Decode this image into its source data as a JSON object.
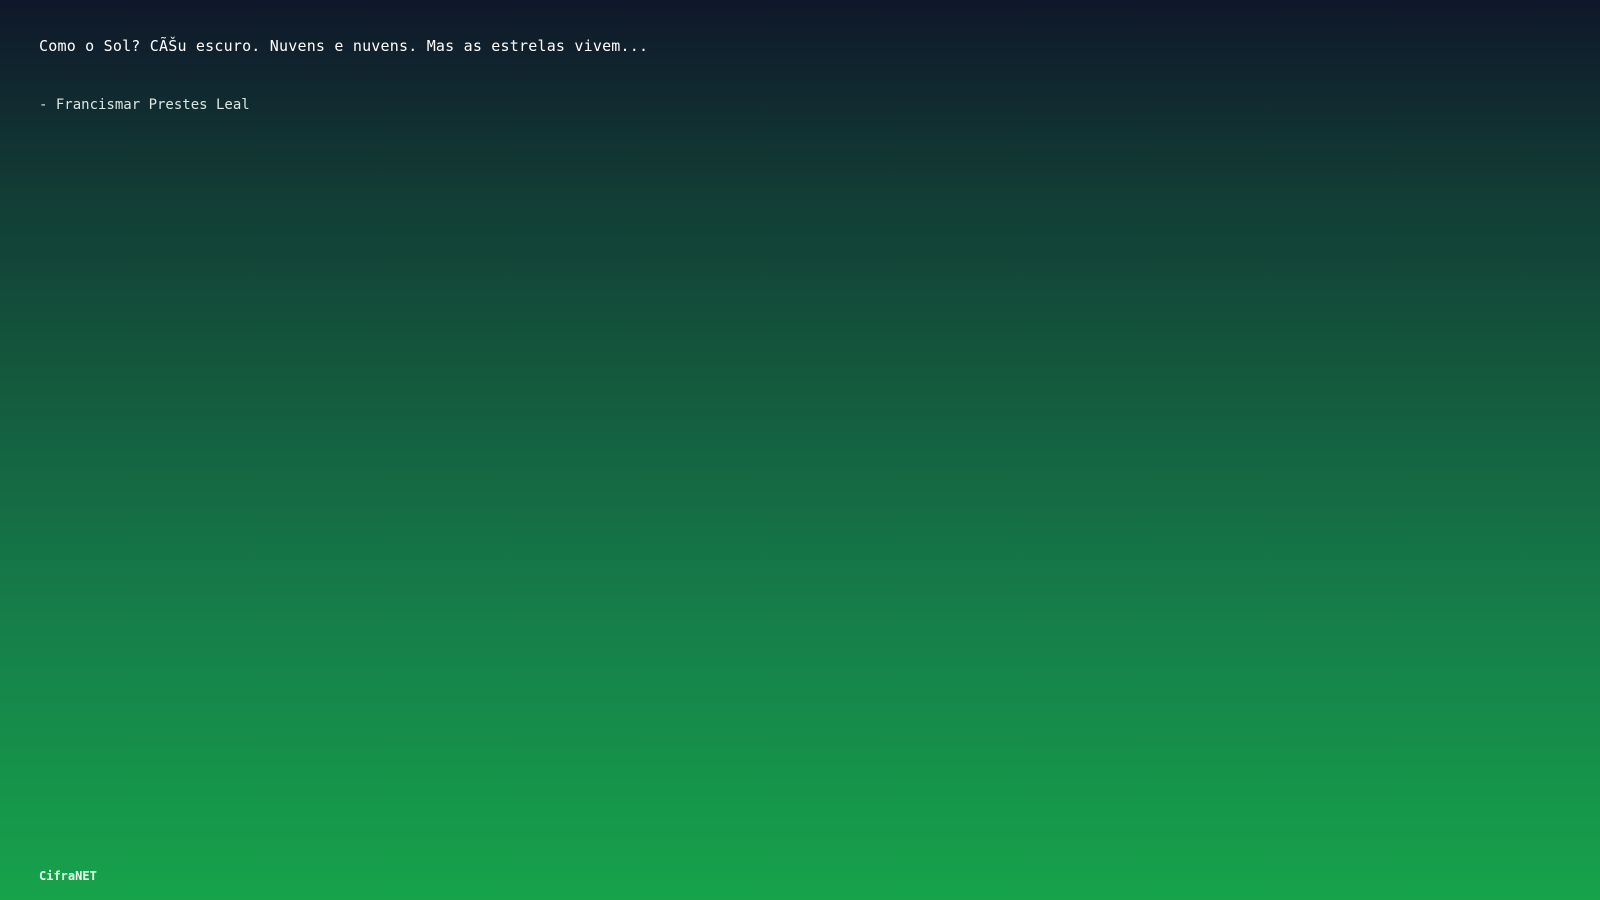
{
  "content": {
    "quote": "Como o Sol? CÃŠu escuro. Nuvens e nuvens. Mas as estrelas vivem...",
    "author": "- Francismar Prestes Leal"
  },
  "footer": {
    "brand": "CifraNET"
  },
  "colors": {
    "gradient_top": "#0f172a",
    "gradient_bottom": "#16a34a",
    "text": "#ffffff"
  }
}
